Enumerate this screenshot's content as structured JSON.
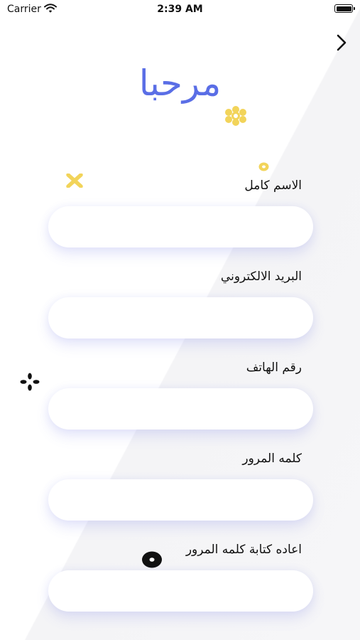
{
  "status_bar": {
    "carrier": "Carrier",
    "time": "2:39 AM"
  },
  "header": {
    "title": "مرحبا"
  },
  "form": {
    "fields": [
      {
        "label": "الاسم كامل",
        "value": ""
      },
      {
        "label": "البريد الالكتروني",
        "value": ""
      },
      {
        "label": "رقم الهاتف",
        "value": ""
      },
      {
        "label": "كلمه المرور",
        "value": ""
      },
      {
        "label": "اعاده كتابة كلمه المرور",
        "value": ""
      }
    ]
  },
  "colors": {
    "accent": "#5a6ee6",
    "decoration": "#f2d45a",
    "field_shadow": "#6e78e6"
  },
  "icons": [
    "wifi-icon",
    "battery-icon",
    "chevron-right-icon",
    "flower-icon",
    "ring-icon",
    "x-shape-icon",
    "sparkle-icon",
    "dot-ring-icon"
  ]
}
